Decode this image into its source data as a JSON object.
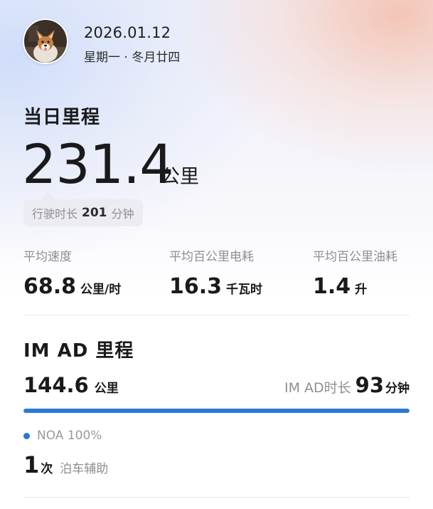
{
  "header": {
    "date": "2026.01.12",
    "lunar": "星期一 · 冬月廿四"
  },
  "daily": {
    "title": "当日里程",
    "mileage": "231.4",
    "mileage_unit": "公里",
    "duration_label": "行驶时长",
    "duration_value": "201",
    "duration_unit": "分钟"
  },
  "stats": [
    {
      "label": "平均速度",
      "value": "68.8",
      "unit": "公里/时"
    },
    {
      "label": "平均百公里电耗",
      "value": "16.3",
      "unit": "千瓦时"
    },
    {
      "label": "平均百公里油耗",
      "value": "1.4",
      "unit": "升"
    }
  ],
  "imad": {
    "title": "IM AD 里程",
    "mileage": "144.6",
    "mileage_unit": "公里",
    "duration_label": "IM AD时长",
    "duration_value": "93",
    "duration_unit": "分钟",
    "progress": 1.0,
    "legend": "NOA 100%",
    "accent_color": "#2a78d6"
  },
  "parking": {
    "count": "1",
    "count_unit": "次",
    "label": "泊车辅助"
  },
  "icons": {
    "avatar": "dog-avatar-photo"
  }
}
